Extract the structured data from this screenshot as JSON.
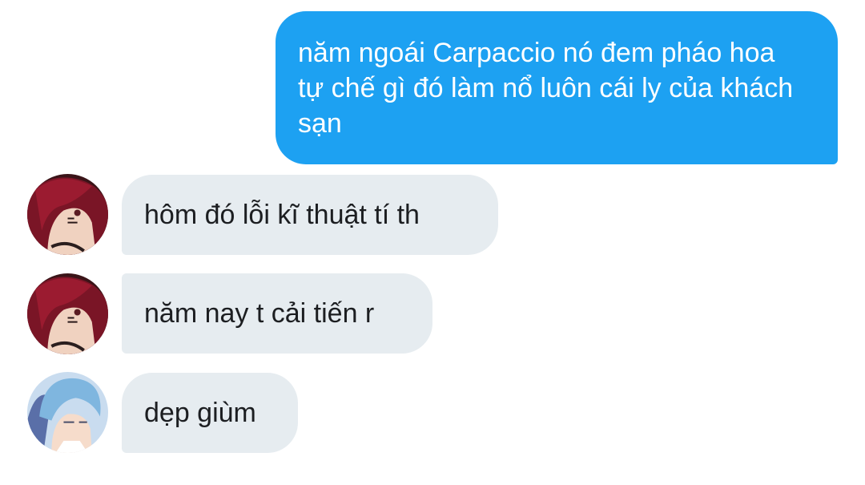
{
  "messages": [
    {
      "direction": "outgoing",
      "text": "năm ngoái Carpaccio nó đem pháo hoa tự chế gì đó làm nổ luôn cái ly của khách sạn"
    },
    {
      "direction": "incoming",
      "avatar": "red-haired-character-avatar",
      "text": "hôm đó lỗi kĩ thuật tí th"
    },
    {
      "direction": "incoming",
      "avatar": "red-haired-character-avatar",
      "text": "năm nay t cải tiến r"
    },
    {
      "direction": "incoming",
      "avatar": "blue-haired-character-avatar",
      "text": "dẹp giùm"
    }
  ],
  "colors": {
    "outgoing_bubble": "#1da1f2",
    "incoming_bubble": "#e6ecf0",
    "background": "#ffffff"
  }
}
